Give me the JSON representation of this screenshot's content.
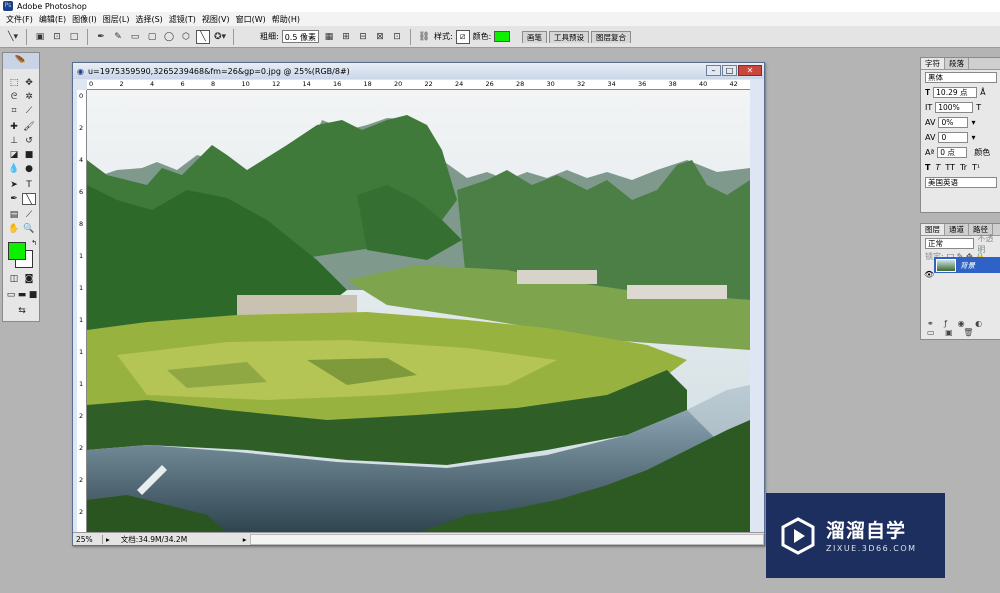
{
  "app": {
    "title": "Adobe Photoshop"
  },
  "menu": [
    "文件(F)",
    "编辑(E)",
    "图像(I)",
    "图层(L)",
    "选择(S)",
    "滤镜(T)",
    "视图(V)",
    "窗口(W)",
    "帮助(H)"
  ],
  "options": {
    "weight_label": "粗细:",
    "weight_value": "0.5 像素",
    "style_label": "样式:",
    "color_label": "颜色:",
    "color": "#0cf000"
  },
  "palette_well": [
    "画笔",
    "工具预设",
    "图层复合"
  ],
  "document": {
    "title": "u=1975359590,3265239468&fm=26&gp=0.jpg @ 25%(RGB/8#)",
    "zoom": "25%",
    "info": "文档:34.9M/34.2M",
    "ruler_top": [
      "0",
      "2",
      "4",
      "6",
      "8",
      "10",
      "12",
      "14",
      "16",
      "18",
      "20",
      "22",
      "24",
      "26",
      "28",
      "30",
      "32",
      "34",
      "36",
      "38",
      "40",
      "42"
    ],
    "ruler_left": [
      "0",
      "2",
      "4",
      "6",
      "8",
      "1",
      "1",
      "1",
      "1",
      "1",
      "2",
      "2",
      "2",
      "2"
    ]
  },
  "character_panel": {
    "tabs": [
      "字符",
      "段落"
    ],
    "font": "黑体",
    "size": "10.29 点",
    "scale": "100%",
    "tracking": "0%",
    "kerning": "0",
    "baseline": "0 点",
    "color_label": "颜色",
    "language": "美国英语",
    "styles": [
      "T",
      "T",
      "TT",
      "Tr",
      "T¹",
      "T₁"
    ]
  },
  "layers_panel": {
    "tabs": [
      "图层",
      "通道",
      "路径"
    ],
    "blend_mode": "正常",
    "opacity_label": "不透明",
    "lock_label": "锁定:",
    "layer_name": "背景"
  },
  "watermark": {
    "title": "溜溜自学",
    "url": "ZIXUE.3D66.COM"
  }
}
